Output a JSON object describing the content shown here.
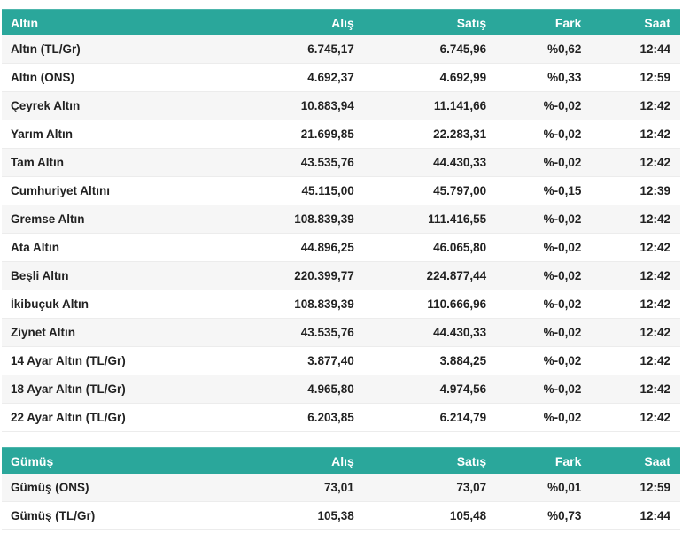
{
  "accent_color": "#2aa79b",
  "row_stripe_color": "#f6f6f6",
  "tables": [
    {
      "id": "gold",
      "columns": [
        "Altın",
        "Alış",
        "Satış",
        "Fark",
        "Saat"
      ],
      "rows": [
        {
          "name": "Altın (TL/Gr)",
          "alis": "6.745,17",
          "satis": "6.745,96",
          "fark": "%0,62",
          "saat": "12:44"
        },
        {
          "name": "Altın (ONS)",
          "alis": "4.692,37",
          "satis": "4.692,99",
          "fark": "%0,33",
          "saat": "12:59"
        },
        {
          "name": "Çeyrek Altın",
          "alis": "10.883,94",
          "satis": "11.141,66",
          "fark": "%-0,02",
          "saat": "12:42"
        },
        {
          "name": "Yarım Altın",
          "alis": "21.699,85",
          "satis": "22.283,31",
          "fark": "%-0,02",
          "saat": "12:42"
        },
        {
          "name": "Tam Altın",
          "alis": "43.535,76",
          "satis": "44.430,33",
          "fark": "%-0,02",
          "saat": "12:42"
        },
        {
          "name": "Cumhuriyet Altını",
          "alis": "45.115,00",
          "satis": "45.797,00",
          "fark": "%-0,15",
          "saat": "12:39"
        },
        {
          "name": "Gremse Altın",
          "alis": "108.839,39",
          "satis": "111.416,55",
          "fark": "%-0,02",
          "saat": "12:42"
        },
        {
          "name": "Ata Altın",
          "alis": "44.896,25",
          "satis": "46.065,80",
          "fark": "%-0,02",
          "saat": "12:42"
        },
        {
          "name": "Beşli Altın",
          "alis": "220.399,77",
          "satis": "224.877,44",
          "fark": "%-0,02",
          "saat": "12:42"
        },
        {
          "name": "İkibuçuk Altın",
          "alis": "108.839,39",
          "satis": "110.666,96",
          "fark": "%-0,02",
          "saat": "12:42"
        },
        {
          "name": "Ziynet Altın",
          "alis": "43.535,76",
          "satis": "44.430,33",
          "fark": "%-0,02",
          "saat": "12:42"
        },
        {
          "name": "14 Ayar Altın (TL/Gr)",
          "alis": "3.877,40",
          "satis": "3.884,25",
          "fark": "%-0,02",
          "saat": "12:42"
        },
        {
          "name": "18 Ayar Altın (TL/Gr)",
          "alis": "4.965,80",
          "satis": "4.974,56",
          "fark": "%-0,02",
          "saat": "12:42"
        },
        {
          "name": "22 Ayar Altın (TL/Gr)",
          "alis": "6.203,85",
          "satis": "6.214,79",
          "fark": "%-0,02",
          "saat": "12:42"
        }
      ]
    },
    {
      "id": "silver",
      "columns": [
        "Gümüş",
        "Alış",
        "Satış",
        "Fark",
        "Saat"
      ],
      "rows": [
        {
          "name": "Gümüş (ONS)",
          "alis": "73,01",
          "satis": "73,07",
          "fark": "%0,01",
          "saat": "12:59"
        },
        {
          "name": "Gümüş (TL/Gr)",
          "alis": "105,38",
          "satis": "105,48",
          "fark": "%0,73",
          "saat": "12:44"
        }
      ]
    }
  ]
}
